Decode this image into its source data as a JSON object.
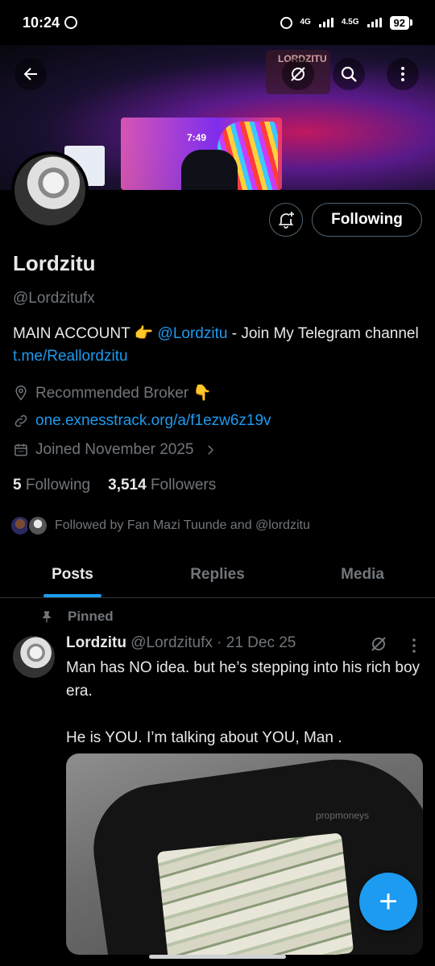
{
  "status_bar": {
    "time": "10:24",
    "network1": "4G",
    "network2": "4.5G",
    "battery": "92"
  },
  "banner": {
    "clock_text": "7:49",
    "sign_text": "LORDZITU"
  },
  "profile": {
    "name": "Lordzitu",
    "handle": "@Lordzitufx",
    "follow_label": "Following",
    "bio_prefix": "MAIN ACCOUNT 👉 ",
    "bio_mention": "@Lordzitu",
    "bio_mid": " - Join My Telegram channel ",
    "bio_link": "t.me/Reallordzitu",
    "location": "Recommended Broker 👇",
    "website": "one.exnesstrack.org/a/f1ezw6z19v",
    "joined": "Joined November 2025",
    "following_count": "5",
    "following_label": "Following",
    "followers_count": "3,514",
    "followers_label": "Followers",
    "followed_by": "Followed by Fan Mazi Tuunde and @lordzitu"
  },
  "tabs": [
    {
      "label": "Posts",
      "active": true
    },
    {
      "label": "Replies",
      "active": false
    },
    {
      "label": "Media",
      "active": false
    }
  ],
  "post": {
    "pinned_label": "Pinned",
    "author": "Lordzitu",
    "meta": "@Lordzitufx · 21 Dec 25",
    "text": "Man has NO idea. but he’s stepping into his rich boy era.\n\nHe is YOU. I’m talking about YOU, Man .",
    "media_watermark": "propmoneys"
  },
  "fab": {
    "icon": "plus-icon"
  },
  "colors": {
    "accent": "#1d9bf0",
    "muted": "#71767b",
    "background": "#000000"
  }
}
